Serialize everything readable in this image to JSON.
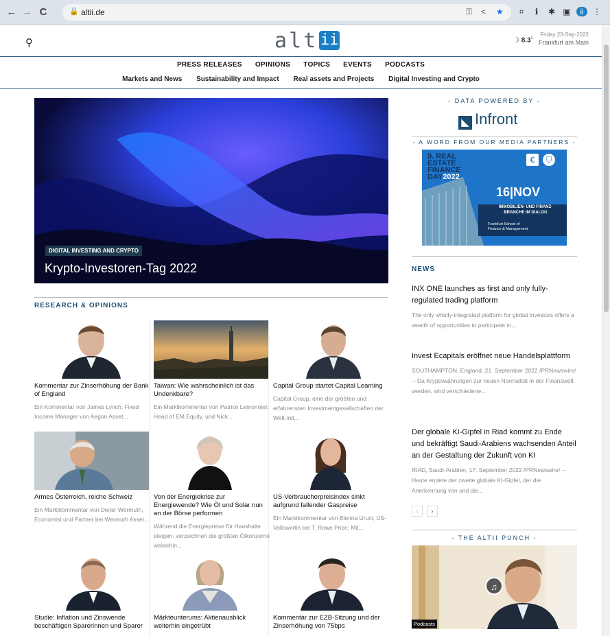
{
  "browser": {
    "url": "altii.de",
    "back": "←",
    "forward": "→",
    "reload": "C"
  },
  "header": {
    "logo_text": "alt",
    "logo_box": "ii",
    "weather_icon": "moon-icon",
    "temperature": "8.3",
    "temp_unit": "C",
    "date": "Friday 23-Sep-2022",
    "location": "Frankfurt am Main"
  },
  "nav_primary": [
    "PRESS RELEASES",
    "OPINIONS",
    "TOPICS",
    "EVENTS",
    "PODCASTS"
  ],
  "nav_secondary": [
    "Markets and News",
    "Sustainability and Impact",
    "Real assets and Projects",
    "Digital Investing and Crypto"
  ],
  "hero": {
    "tag": "DIGITAL INVESTING AND CRYPTO",
    "title": "Krypto-Investoren-Tag 2022"
  },
  "research": {
    "heading": "RESEARCH & OPINIONS",
    "cards": [
      {
        "title": "Kommentar zur Zinserhöhung der Bank of England",
        "excerpt": "Ein Kommentar von James Lynch, Fixed Income Manager von Aegon Asset..."
      },
      {
        "title": "Taiwan: Wie wahrscheinlich ist das Undenkbare?",
        "excerpt": "Ein Marktkommentar von Patrice Lemonnier, Head of EM Equity, und Nick..."
      },
      {
        "title": "Capital Group startet Capital Learning",
        "excerpt": "Capital Group, eine der größten und erfahrensten Investmentgesellschaften der Welt mit..."
      },
      {
        "title": "Armes Österreich, reiche Schweiz",
        "excerpt": "Ein Marktkommentar von Dieter Wermuth, Economist und Partner bei Wermuth Asset..."
      },
      {
        "title": "Von der Energiekrise zur Energiewende? Wie Öl und Solar nun an der Börse performen",
        "excerpt": "Während die Energiepreise für Haushalte steigen, verzeichnen die größten Ölkonzerne weiterhin..."
      },
      {
        "title": "US-Verbraucherpreisindex sinkt aufgrund fallender Gaspreise",
        "excerpt": "Ein Marktkommentar von Blerina Uruci, US-Volkswirtin bei T. Rowe Price: Mit..."
      },
      {
        "title": "Studie: Inflation und Zinswende beschäftigen Sparerinnen und Sparer",
        "excerpt": ""
      },
      {
        "title": "Märkteunterums: Aktienausblick weiterhin eingetrübt",
        "excerpt": ""
      },
      {
        "title": "Kommentar zur EZB-Sitzung und der Zinserhöhung von 75bps",
        "excerpt": ""
      }
    ]
  },
  "sidebar": {
    "data_powered": "- DATA POWERED BY -",
    "infront": "Infront",
    "media_partners": "- A WORD FROM OUR MEDIA PARTNERS -",
    "ad": {
      "line1": "9. REAL",
      "line2": "ESTATE",
      "line3": "FINANCE",
      "line4": "DAY",
      "year": "2022",
      "date": "16|NOV",
      "sub1": "IMMOBILIEN- UND FINANZ-",
      "sub2": "BRANCHE IM DIALOG",
      "org1": "Frankfurt School of",
      "org2": "Finance & Management"
    },
    "news_heading": "NEWS",
    "news": [
      {
        "title": "INX ONE launches as first and only fully-regulated trading platform",
        "excerpt": "The only wholly-integrated platform for global investors offers a wealth of opportunities to participate in,..."
      },
      {
        "title": "Invest Ecapitals eröffnet neue Handelsplattform",
        "excerpt": "SOUTHAMPTON, England, 21. September 2022 /PRNewswire/ -- Da Kryptowährungen zur neuen Normalität in der Finanzwelt werden, sind verschiedene..."
      },
      {
        "title": "Der globale KI-Gipfel in Riad kommt zu Ende und bekräftigt Saudi-Arabiens wachsenden Anteil an der Gestaltung der Zukunft von KI",
        "excerpt": "RIAD, Saudi-Arabien, 17. September 2022 /PRNewswire/ -- Heute endete der zweite globale KI-Gipfel, der die Anerkennung von und die..."
      }
    ],
    "pager_prev": "‹",
    "pager_next": "›",
    "punch_heading": "- THE ALTII PUNCH -",
    "punch_badge": "Podcasts"
  }
}
